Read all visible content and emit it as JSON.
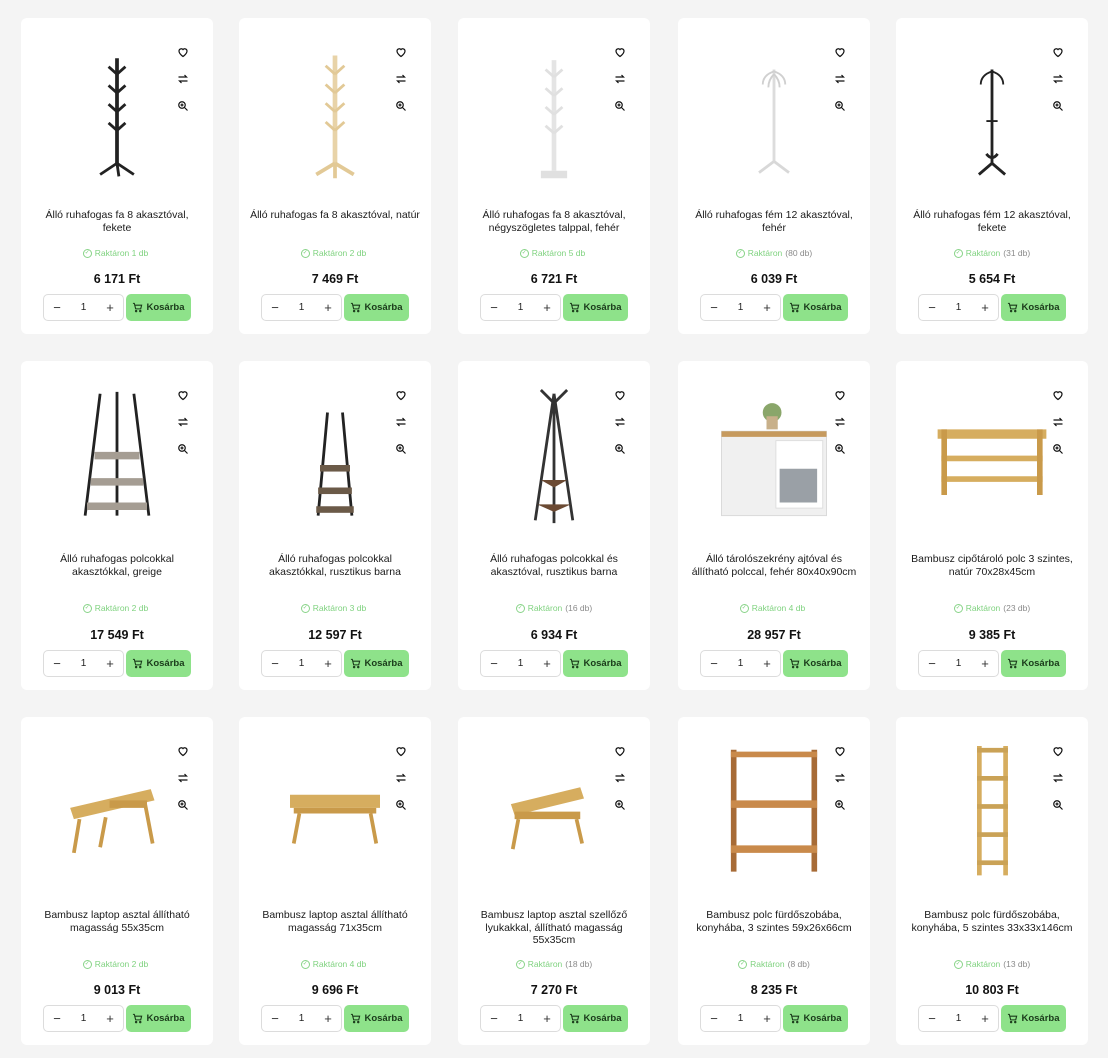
{
  "currency": "Ft",
  "stepper_default": "1",
  "cart_label": "Kosárba",
  "colors": {
    "accent": "#8ee28a",
    "stock_green": "#7fd27f",
    "page_bg": "#f4f4f4"
  },
  "icons": {
    "wishlist": "heart-icon",
    "compare": "compare-arrows-icon",
    "zoom": "zoom-icon",
    "cart": "cart-icon",
    "stock": "check-circle-icon"
  },
  "products": [
    {
      "title": "Álló ruhafogas fa 8 akasztóval, fekete",
      "stock_label": "Raktáron 1 db",
      "stock_qty": "",
      "price": "6 171 Ft",
      "image": "coat-stand-black"
    },
    {
      "title": "Álló ruhafogas fa 8 akasztóval, natúr",
      "stock_label": "Raktáron 2 db",
      "stock_qty": "",
      "price": "7 469 Ft",
      "image": "coat-stand-natural"
    },
    {
      "title": "Álló ruhafogas fa 8 akasztóval, négyszögletes talppal, fehér",
      "stock_label": "Raktáron 5 db",
      "stock_qty": "",
      "price": "6 721 Ft",
      "image": "coat-stand-white"
    },
    {
      "title": "Álló ruhafogas fém 12 akasztóval, fehér",
      "stock_label": "Raktáron",
      "stock_qty": "(80 db)",
      "price": "6 039 Ft",
      "image": "metal-stand-white"
    },
    {
      "title": "Álló ruhafogas fém 12 akasztóval, fekete",
      "stock_label": "Raktáron",
      "stock_qty": "(31 db)",
      "price": "5 654 Ft",
      "image": "metal-stand-black"
    },
    {
      "title": "Álló ruhafogas polcokkal akasztókkal, greige",
      "stock_label": "Raktáron 2 db",
      "stock_qty": "",
      "price": "17 549 Ft",
      "image": "shelf-stand-greige"
    },
    {
      "title": "Álló ruhafogas polcokkal akasztókkal, rusztikus barna",
      "stock_label": "Raktáron 3 db",
      "stock_qty": "",
      "price": "12 597 Ft",
      "image": "shelf-stand-brown"
    },
    {
      "title": "Álló ruhafogas polcokkal és akasztóval, rusztikus barna",
      "stock_label": "Raktáron",
      "stock_qty": "(16 db)",
      "price": "6 934 Ft",
      "image": "tripod-stand-brown"
    },
    {
      "title": "Álló tárolószekrény ajtóval és állítható polccal, fehér 80x40x90cm",
      "stock_label": "Raktáron 4 db",
      "stock_qty": "",
      "price": "28 957 Ft",
      "image": "cabinet-white"
    },
    {
      "title": "Bambusz cipőtároló polc 3 szintes, natúr 70x28x45cm",
      "stock_label": "Raktáron",
      "stock_qty": "(23 db)",
      "price": "9 385 Ft",
      "image": "shoe-rack-bamboo"
    },
    {
      "title": "Bambusz laptop asztal állítható magasság 55x35cm",
      "stock_label": "Raktáron 2 db",
      "stock_qty": "",
      "price": "9 013 Ft",
      "image": "laptop-table-55"
    },
    {
      "title": "Bambusz laptop asztal állítható magasság 71x35cm",
      "stock_label": "Raktáron 4 db",
      "stock_qty": "",
      "price": "9 696 Ft",
      "image": "laptop-table-71"
    },
    {
      "title": "Bambusz laptop asztal szellőző lyukakkal, állítható magasság 55x35cm",
      "stock_label": "Raktáron",
      "stock_qty": "(18 db)",
      "price": "7 270 Ft",
      "image": "laptop-table-vent"
    },
    {
      "title": "Bambusz polc fürdőszobába, konyhába, 3 szintes 59x26x66cm",
      "stock_label": "Raktáron",
      "stock_qty": "(8 db)",
      "price": "8 235 Ft",
      "image": "bamboo-shelf-3"
    },
    {
      "title": "Bambusz polc fürdőszobába, konyhába, 5 szintes 33x33x146cm",
      "stock_label": "Raktáron",
      "stock_qty": "(13 db)",
      "price": "10 803 Ft",
      "image": "bamboo-shelf-5"
    }
  ]
}
